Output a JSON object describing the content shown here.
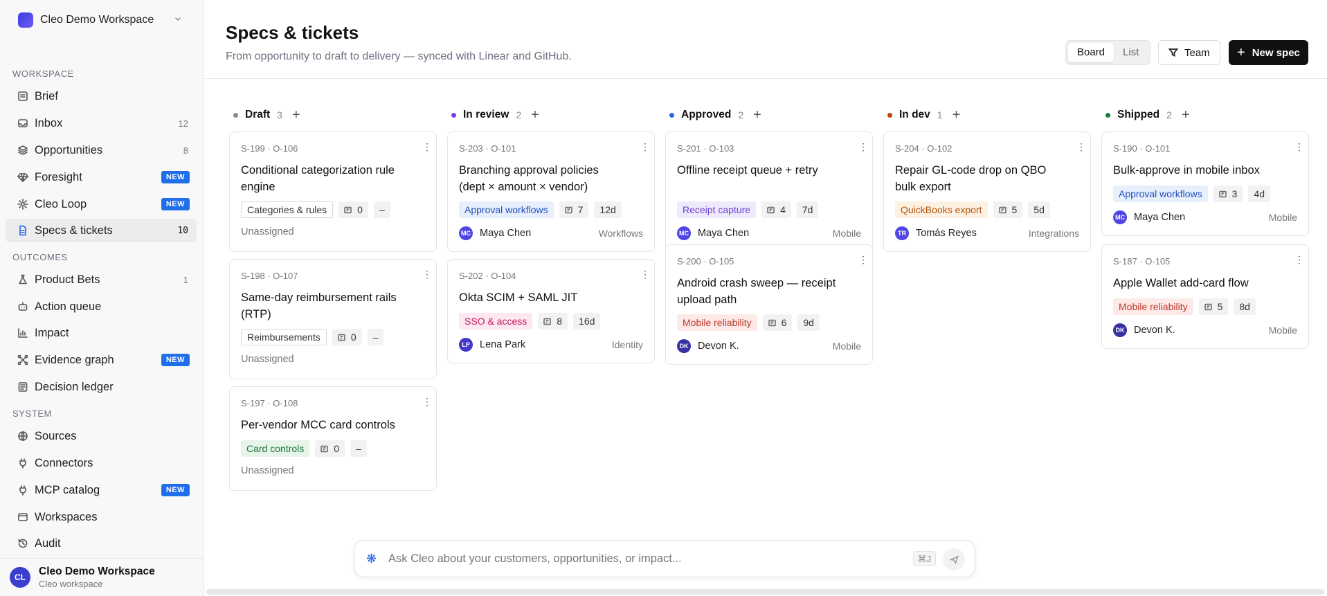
{
  "workspace": {
    "name": "Cleo Demo Workspace"
  },
  "sidebar": {
    "sections": [
      "WORKSPACE",
      "OUTCOMES",
      "SYSTEM"
    ],
    "items": [
      {
        "label": "Brief",
        "icon": "brief-icon"
      },
      {
        "label": "Inbox",
        "icon": "inbox-icon",
        "count": "12"
      },
      {
        "label": "Opportunities",
        "icon": "layers-icon",
        "count": "8"
      },
      {
        "label": "Foresight",
        "icon": "gem-icon",
        "badge": "NEW"
      },
      {
        "label": "Cleo Loop",
        "icon": "sparkle-icon",
        "badge": "NEW"
      },
      {
        "label": "Specs & tickets",
        "icon": "doc-icon",
        "count": "10",
        "active": true
      },
      {
        "label": "Product Bets",
        "icon": "flask-icon",
        "count": "1"
      },
      {
        "label": "Action queue",
        "icon": "bot-icon"
      },
      {
        "label": "Impact",
        "icon": "bar-chart-icon"
      },
      {
        "label": "Evidence graph",
        "icon": "graph-icon",
        "badge": "NEW"
      },
      {
        "label": "Decision ledger",
        "icon": "ledger-icon"
      },
      {
        "label": "Sources",
        "icon": "globe-icon"
      },
      {
        "label": "Connectors",
        "icon": "plug-icon"
      },
      {
        "label": "MCP catalog",
        "icon": "plug-icon",
        "badge": "NEW"
      },
      {
        "label": "Workspaces",
        "icon": "window-icon"
      },
      {
        "label": "Audit",
        "icon": "history-icon"
      }
    ],
    "footer": {
      "initials": "CL",
      "name": "Cleo Demo Workspace",
      "sub": "Cleo workspace"
    }
  },
  "header": {
    "title": "Specs & tickets",
    "subtitle": "From opportunity to draft to delivery — synced with Linear and GitHub.",
    "view_board": "Board",
    "view_list": "List",
    "team": "Team",
    "new_spec": "New spec"
  },
  "columns": [
    {
      "name": "Draft",
      "count": "3",
      "color": "#8a8a8a",
      "cards": [
        {
          "id": "S-199",
          "opp": "· O-106",
          "title": "Conditional categorization rule engine",
          "tag": "Categories & rules",
          "tag_style": "outline",
          "links": "0",
          "age": "–",
          "assignee": "Unassigned"
        },
        {
          "id": "S-198",
          "opp": "· O-107",
          "title": "Same-day reimbursement rails (RTP)",
          "tag": "Reimbursements",
          "tag_style": "outline",
          "links": "0",
          "age": "–",
          "assignee": "Unassigned"
        },
        {
          "id": "S-197",
          "opp": "· O-108",
          "title": "Per-vendor MCC card controls",
          "tag": "Card controls",
          "tag_style": "green",
          "links": "0",
          "age": "–",
          "assignee": "Unassigned"
        }
      ]
    },
    {
      "name": "In review",
      "count": "2",
      "color": "#7c3aed",
      "cards": [
        {
          "id": "S-203",
          "opp": "· O-101",
          "title": "Branching approval policies (dept × amount × vendor)",
          "tag": "Approval workflows",
          "tag_style": "blue",
          "links": "7",
          "age": "12d",
          "initials": "MC",
          "assignee": "Maya Chen",
          "team": "Workflows"
        },
        {
          "id": "S-202",
          "opp": "· O-104",
          "title": "Okta SCIM + SAML JIT",
          "tag": "SSO & access",
          "tag_style": "pink",
          "links": "8",
          "age": "16d",
          "initials": "LP",
          "assignee": "Lena Park",
          "team": "Identity"
        }
      ]
    },
    {
      "name": "Approved",
      "count": "2",
      "color": "#2563eb",
      "cards": [
        {
          "id": "S-201",
          "opp": "· O-103",
          "title": "Offline receipt queue + retry",
          "tag": "Receipt capture",
          "tag_style": "purple",
          "links": "4",
          "age": "7d",
          "initials": "MC",
          "assignee": "Maya Chen",
          "team": "Mobile"
        },
        {
          "id": "S-200",
          "opp": "· O-105",
          "title": "Android crash sweep — receipt upload path",
          "tag": "Mobile reliability",
          "tag_style": "red",
          "links": "6",
          "age": "9d",
          "initials": "DK",
          "assignee": "Devon K.",
          "team": "Mobile"
        }
      ]
    },
    {
      "name": "In dev",
      "count": "1",
      "color": "#c2410c",
      "cards": [
        {
          "id": "S-204",
          "opp": "· O-102",
          "title": "Repair GL-code drop on QBO bulk export",
          "tag": "QuickBooks export",
          "tag_style": "orange",
          "links": "5",
          "age": "5d",
          "initials": "TR",
          "assignee": "Tomás Reyes",
          "team": "Integrations"
        }
      ]
    },
    {
      "name": "Shipped",
      "count": "2",
      "color": "#15803d",
      "cards": [
        {
          "id": "S-190",
          "opp": "· O-101",
          "title": "Bulk-approve in mobile inbox",
          "tag": "Approval workflows",
          "tag_style": "blue",
          "links": "3",
          "age": "4d",
          "initials": "MC",
          "assignee": "Maya Chen",
          "team": "Mobile"
        },
        {
          "id": "S-187",
          "opp": "· O-105",
          "title": "Apple Wallet add-card flow",
          "tag": "Mobile reliability",
          "tag_style": "red",
          "links": "5",
          "age": "8d",
          "initials": "DK",
          "assignee": "Devon K.",
          "team": "Mobile"
        }
      ]
    }
  ],
  "ask": {
    "placeholder": "Ask Cleo about your customers, opportunities, or impact...",
    "shortcut": "⌘J"
  }
}
